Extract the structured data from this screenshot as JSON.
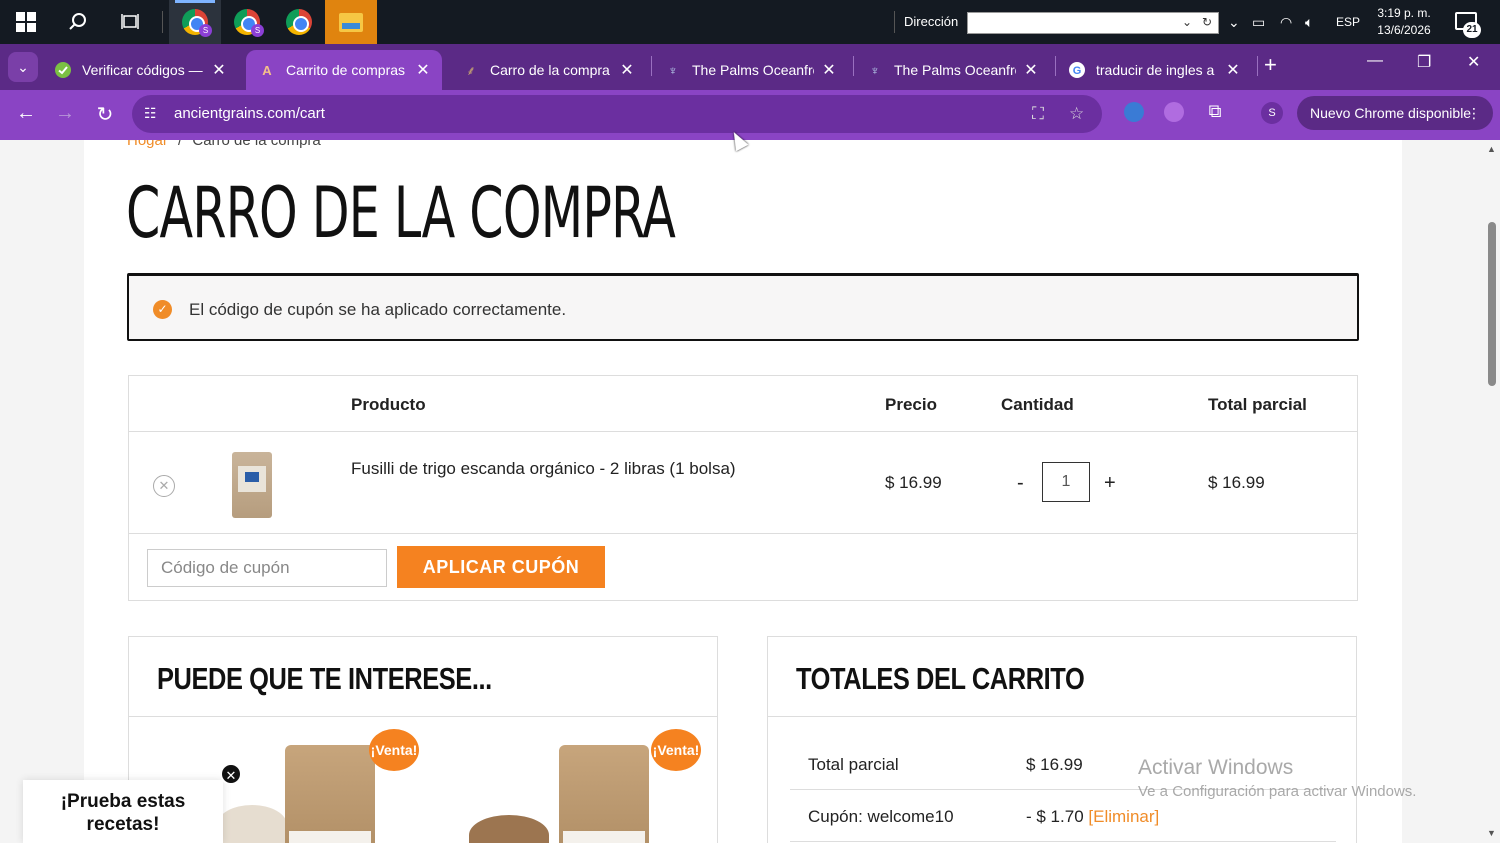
{
  "taskbar": {
    "address_label": "Dirección",
    "address_value": "",
    "language": "ESP",
    "time": "3:19 p. m.",
    "date": "13/6/2026",
    "notifications": "21"
  },
  "tabs": [
    {
      "title": "Verificar códigos — S",
      "favicon": "check-icon"
    },
    {
      "title": "Carrito de compras | A",
      "favicon": "ancient-grains-icon",
      "active": true
    },
    {
      "title": "Carro de la compra",
      "favicon": "wheat-icon"
    },
    {
      "title": "The Palms Oceanfront",
      "favicon": "palm-icon"
    },
    {
      "title": "The Palms Oceanfront",
      "favicon": "palm-icon"
    },
    {
      "title": "traducir de ingles a e",
      "favicon": "google-icon"
    }
  ],
  "toolbar": {
    "url": "ancientgrains.com/cart",
    "update_label": "Nuevo Chrome disponible",
    "profile_initial": "S"
  },
  "page": {
    "breadcrumb_home": "Hogar",
    "breadcrumb_sep": "/",
    "breadcrumb_current": "Carro de la compra",
    "title": "CARRO DE LA COMPRA",
    "notice": "El código de cupón se ha aplicado correctamente.",
    "cart": {
      "headers": {
        "product": "Producto",
        "price": "Precio",
        "quantity": "Cantidad",
        "subtotal": "Total parcial"
      },
      "items": [
        {
          "name": "Fusilli de trigo escanda orgánico - 2 libras (1 bolsa)",
          "price": "$ 16.99",
          "quantity": "1",
          "subtotal": "$ 16.99"
        }
      ],
      "qty_minus": "-",
      "qty_plus": "+",
      "coupon_placeholder": "Código de cupón",
      "coupon_button": "APLICAR CUPÓN"
    },
    "cross_sells": {
      "title": "PUEDE QUE TE INTERESE...",
      "sale_badge": "¡Venta!"
    },
    "totals": {
      "title": "TOTALES DEL CARRITO",
      "rows": [
        {
          "label": "Total parcial",
          "value": "$ 16.99"
        },
        {
          "label": "Cupón: welcome10",
          "value": "- $ 1.70",
          "remove": "[Eliminar]"
        }
      ]
    },
    "popup": "¡Prueba estas recetas!"
  },
  "watermark": {
    "line1": "Activar Windows",
    "line2": "Ve a Configuración para activar Windows."
  },
  "colors": {
    "accent": "#f58220",
    "chrome_tab": "#8a44c4",
    "chrome_frame": "#5b2a86"
  }
}
